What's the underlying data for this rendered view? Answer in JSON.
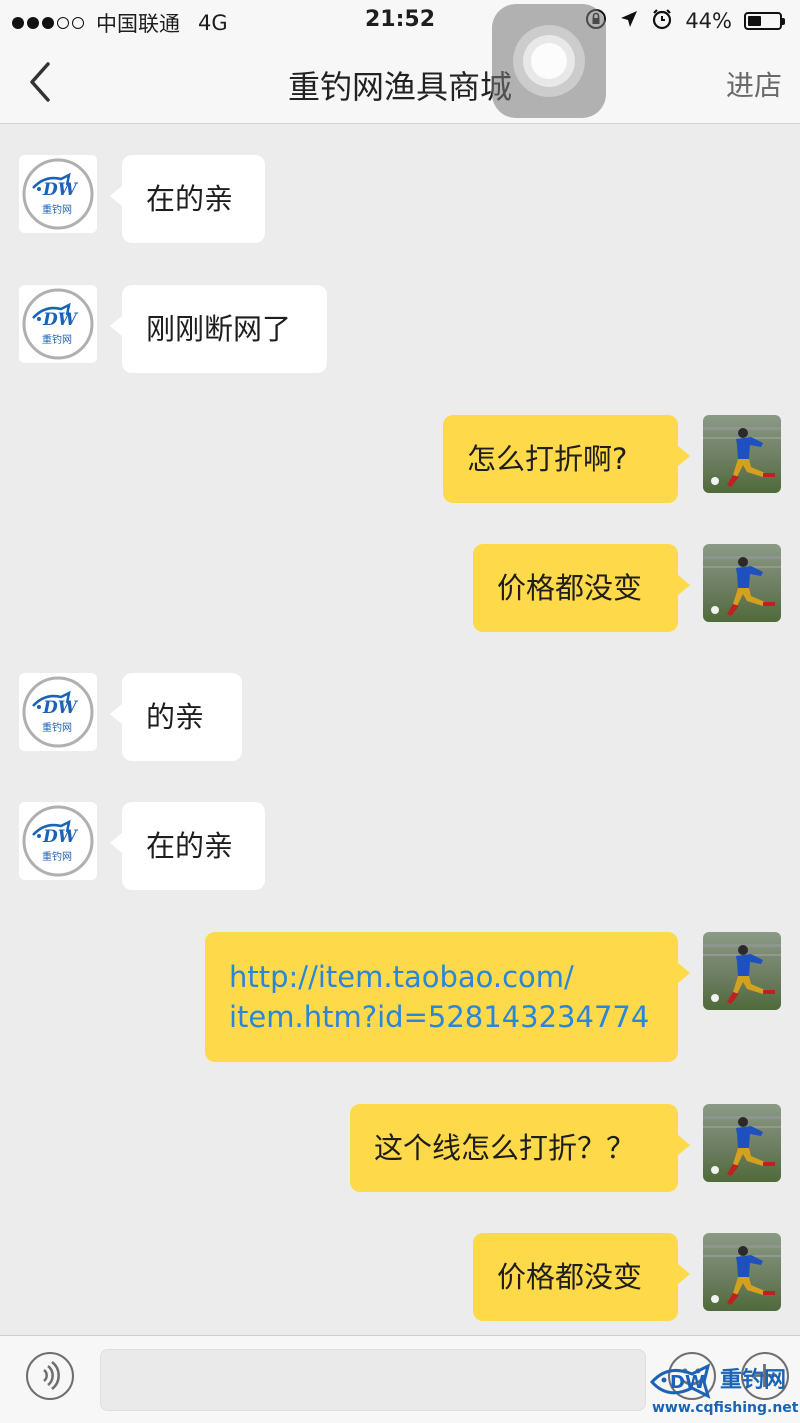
{
  "status_bar": {
    "carrier": "中国联通",
    "network": "4G",
    "time": "21:52",
    "battery": "44%",
    "battery_level": 0.44,
    "signal_bars_filled": 3,
    "signal_bars_total": 5,
    "icons": [
      "orientation-lock-icon",
      "location-arrow-icon",
      "alarm-icon",
      "battery-icon"
    ]
  },
  "nav": {
    "title": "重钓网渔具商城",
    "action_label": "进店",
    "back_icon": "chevron-left-icon"
  },
  "messages": [
    {
      "side": "in",
      "sender": "shop",
      "text": "在的亲"
    },
    {
      "side": "in",
      "sender": "shop",
      "text": "刚刚断网了"
    },
    {
      "side": "out",
      "sender": "user",
      "text": "怎么打折啊?"
    },
    {
      "side": "out",
      "sender": "user",
      "text": "价格都没变"
    },
    {
      "side": "in",
      "sender": "shop",
      "text": "的亲"
    },
    {
      "side": "in",
      "sender": "shop",
      "text": "在的亲"
    },
    {
      "side": "out",
      "sender": "user",
      "text": "http://item.taobao.com/item.htm?id=528143234774",
      "line1": "http://item.taobao.com/",
      "line2": "item.htm?id=528143234774",
      "is_link": true
    },
    {
      "side": "out",
      "sender": "user",
      "text": "这个线怎么打折？？"
    },
    {
      "side": "out",
      "sender": "user",
      "text": "价格都没变"
    }
  ],
  "shop_avatar": {
    "logo_text": "DW",
    "logo_sub": "重钓网",
    "icon": "fish-logo-icon"
  },
  "input_bar": {
    "placeholder": "",
    "icons": [
      "voice-icon",
      "emoji-icon",
      "plus-icon"
    ]
  },
  "watermark": {
    "text": "重钓网",
    "url": "www.cqfishing.net",
    "logo_text": "DW"
  },
  "colors": {
    "outgoing_bubble": "#fed94a",
    "incoming_bubble": "#ffffff",
    "chat_background": "#ececec",
    "link": "#2a86d8",
    "brand_blue": "#1b63b5"
  }
}
